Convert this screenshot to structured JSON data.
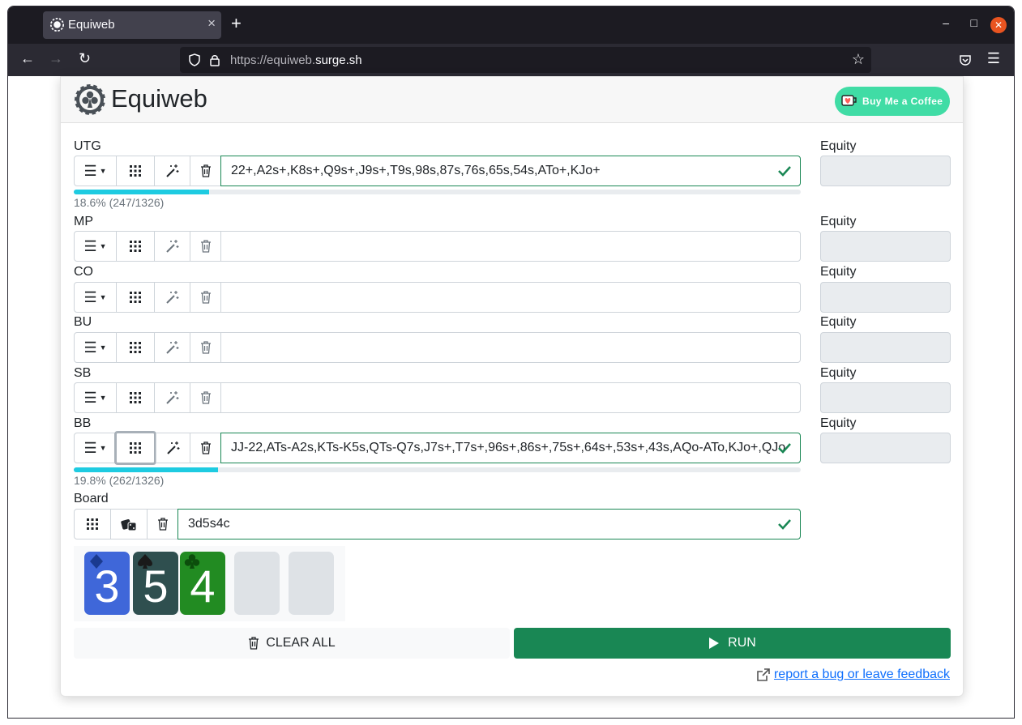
{
  "browser": {
    "tab_title": "Equiweb",
    "url_prefix": "https://equiweb.",
    "url_domain": "surge.sh"
  },
  "app": {
    "title": "Equiweb",
    "coffee_label": "Buy Me a Coffee"
  },
  "players": [
    {
      "label": "UTG",
      "range": "22+,A2s+,K8s+,Q9s+,J9s+,T9s,98s,87s,76s,65s,54s,ATo+,KJo+",
      "progress_pct": 18.6,
      "progress_text": "18.6% (247/1326)",
      "equity_label": "Equity"
    },
    {
      "label": "MP",
      "range": "",
      "equity_label": "Equity"
    },
    {
      "label": "CO",
      "range": "",
      "equity_label": "Equity"
    },
    {
      "label": "BU",
      "range": "",
      "equity_label": "Equity"
    },
    {
      "label": "SB",
      "range": "",
      "equity_label": "Equity"
    },
    {
      "label": "BB",
      "range": "JJ-22,ATs-A2s,KTs-K5s,QTs-Q7s,J7s+,T7s+,96s+,86s+,75s+,64s+,53s+,43s,AQo-ATo,KJo+,QJo",
      "progress_pct": 19.8,
      "progress_text": "19.8% (262/1326)",
      "equity_label": "Equity"
    }
  ],
  "board": {
    "label": "Board",
    "value": "3d5s4c",
    "cards": [
      {
        "rank": "3",
        "suit": "diamond",
        "color": "#3f67d9"
      },
      {
        "rank": "5",
        "suit": "spade",
        "color": "#2f4f4f"
      },
      {
        "rank": "4",
        "suit": "club",
        "color": "#228b22"
      }
    ]
  },
  "actions": {
    "clear_label": "CLEAR ALL",
    "run_label": "RUN",
    "feedback_label": "report a bug or leave feedback"
  },
  "colors": {
    "success": "#198754",
    "progress": "#1ecbe1",
    "coffee": "#40dca5"
  }
}
